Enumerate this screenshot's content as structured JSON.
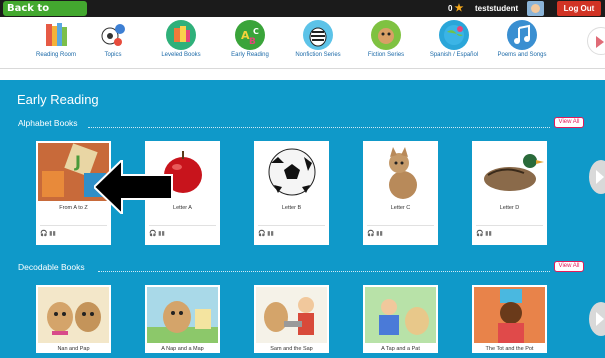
{
  "topbar": {
    "back_label": "Back to Reading",
    "stars_count": "0",
    "username": "teststudent",
    "logout_label": "Log Out"
  },
  "nav": {
    "items": [
      {
        "label": "Reading Room",
        "icon": "books-icon"
      },
      {
        "label": "Topics",
        "icon": "topics-icon"
      },
      {
        "label": "Leveled Books",
        "icon": "leveled-books-icon"
      },
      {
        "label": "Early Reading",
        "icon": "abc-icon"
      },
      {
        "label": "Nonfiction Series",
        "icon": "zebra-icon"
      },
      {
        "label": "Fiction Series",
        "icon": "dog-icon"
      },
      {
        "label": "Spanish / Español",
        "icon": "globe-icon"
      },
      {
        "label": "Poems and Songs",
        "icon": "music-icon"
      }
    ]
  },
  "main": {
    "title": "Early Reading",
    "sections": [
      {
        "label": "Alphabet Books",
        "view_all": "View All",
        "books": [
          {
            "title": "From A to Z"
          },
          {
            "title": "Letter A"
          },
          {
            "title": "Letter B"
          },
          {
            "title": "Letter C"
          },
          {
            "title": "Letter D"
          }
        ]
      },
      {
        "label": "Decodable Books",
        "view_all": "View All",
        "books": [
          {
            "title": "Nan and Pap"
          },
          {
            "title": "A Nap and a Map"
          },
          {
            "title": "Sam and the Sap"
          },
          {
            "title": "A Tap and a Pat"
          },
          {
            "title": "The Tot and the Pot"
          }
        ]
      }
    ]
  },
  "colors": {
    "accent_green": "#43a82f",
    "logout_red": "#d13324",
    "background_blue": "#0f99c9",
    "view_all_pink": "#e21b5a"
  }
}
